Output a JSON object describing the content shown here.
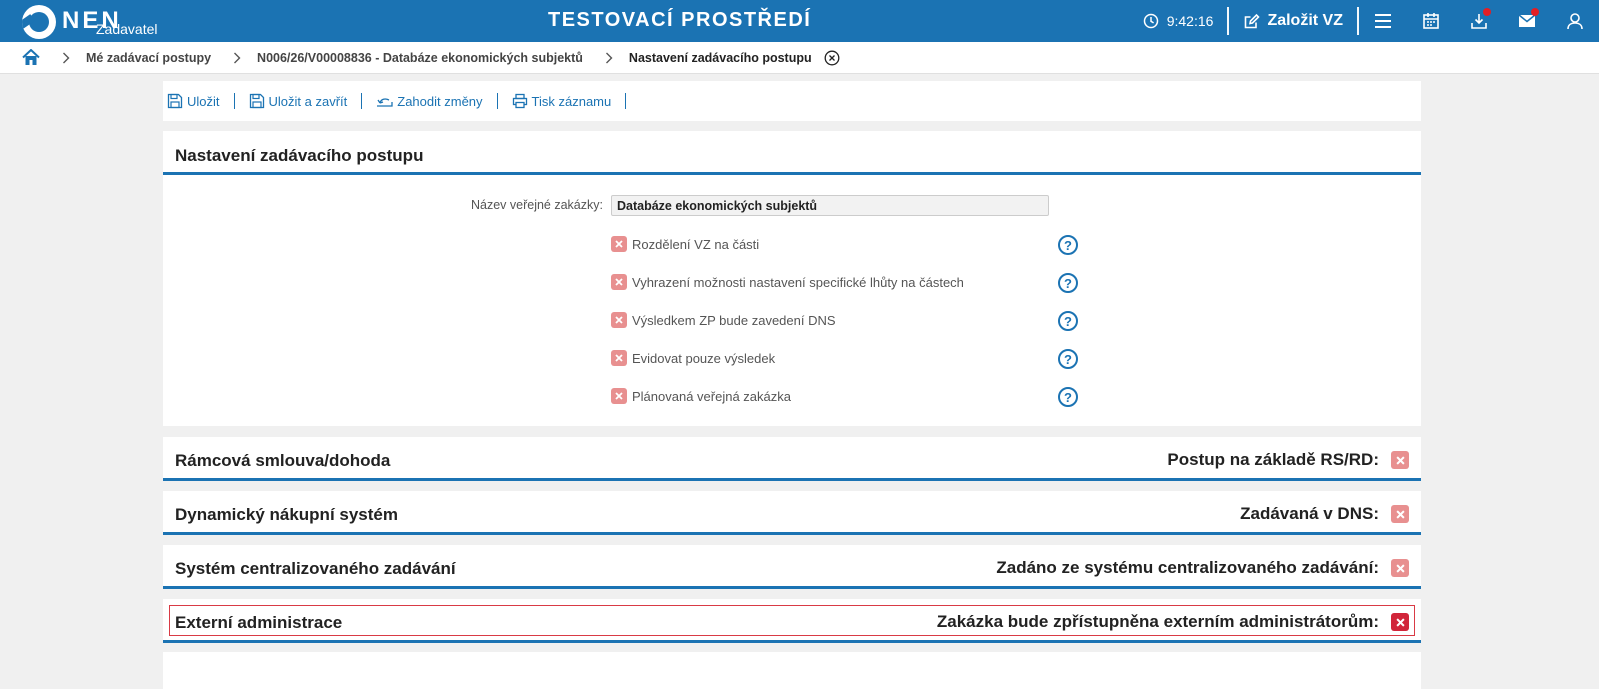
{
  "topbar": {
    "logo_text": "NEN",
    "logo_sub": "Zadavatel",
    "env_title": "TESTOVACÍ PROSTŘEDÍ",
    "clock": "9:42:16",
    "create_label": "Založit VZ"
  },
  "breadcrumb": {
    "items": [
      "Mé zadávací postupy",
      "N006/26/V00008836 - Databáze ekonomických subjektů"
    ],
    "current": "Nastavení zadávacího postupu"
  },
  "toolbar": {
    "save": "Uložit",
    "save_close": "Uložit a zavřít",
    "discard": "Zahodit změny",
    "print": "Tisk záznamu"
  },
  "main": {
    "title": "Nastavení zadávacího postupu",
    "name_label": "Název veřejné zakázky:",
    "name_value": "Databáze ekonomických subjektů",
    "options": [
      "Rozdělení VZ na části",
      "Vyhrazení možnosti nastavení specifické lhůty na částech",
      "Výsledkem ZP bude zavedení DNS",
      "Evidovat pouze výsledek",
      "Plánovaná veřejná zakázka"
    ]
  },
  "sections": [
    {
      "title": "Rámcová smlouva/dohoda",
      "right_label": "Postup na základě RS/RD:"
    },
    {
      "title": "Dynamický nákupní systém",
      "right_label": "Zadávaná v DNS:"
    },
    {
      "title": "Systém centralizovaného zadávání",
      "right_label": "Zadáno ze systému centralizovaného zadávání:"
    },
    {
      "title": "Externí administrace",
      "right_label": "Zakázka bude zpřístupněna externím administrátorům:"
    }
  ],
  "colors": {
    "brand": "#1b73b3",
    "checkbox_off": "#e89090",
    "checkbox_active": "#d1253a",
    "notification": "#e31e24"
  }
}
